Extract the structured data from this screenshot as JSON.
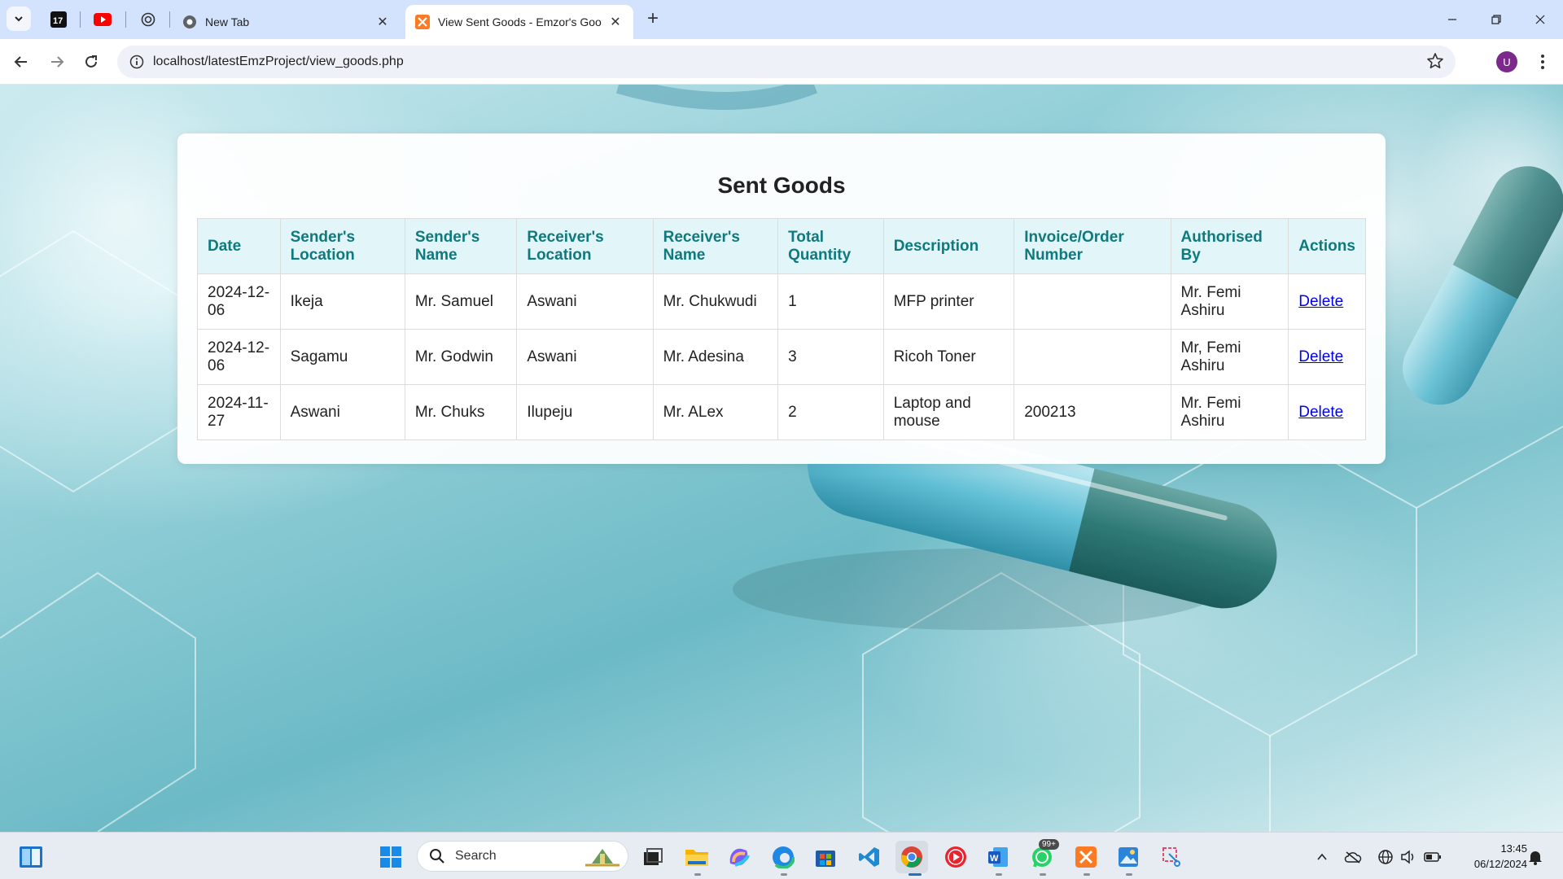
{
  "browser": {
    "tabs": [
      {
        "label": "New Tab"
      },
      {
        "label": "View Sent Goods - Emzor's Goo"
      }
    ],
    "url": "localhost/latestEmzProject/view_goods.php",
    "profile_initial": "U"
  },
  "page": {
    "heading": "Sent Goods",
    "columns": [
      "Date",
      "Sender's Location",
      "Sender's Name",
      "Receiver's Location",
      "Receiver's Name",
      "Total Quantity",
      "Description",
      "Invoice/Order Number",
      "Authorised By",
      "Actions"
    ],
    "rows": [
      {
        "date": "2024-12-06",
        "sender_location": "Ikeja",
        "sender_name": "Mr. Samuel",
        "receiver_location": "Aswani",
        "receiver_name": "Mr. Chukwudi",
        "quantity": "1",
        "description": "MFP printer",
        "invoice": "",
        "authorised_by": "Mr. Femi Ashiru",
        "action": "Delete"
      },
      {
        "date": "2024-12-06",
        "sender_location": "Sagamu",
        "sender_name": "Mr. Godwin",
        "receiver_location": "Aswani",
        "receiver_name": "Mr. Adesina",
        "quantity": "3",
        "description": "Ricoh Toner",
        "invoice": "",
        "authorised_by": "Mr, Femi Ashiru",
        "action": "Delete"
      },
      {
        "date": "2024-11-27",
        "sender_location": "Aswani",
        "sender_name": "Mr. Chuks",
        "receiver_location": "Ilupeju",
        "receiver_name": "Mr. ALex",
        "quantity": "2",
        "description": "Laptop and mouse",
        "invoice": "200213",
        "authorised_by": "Mr. Femi Ashiru",
        "action": "Delete"
      }
    ]
  },
  "taskbar": {
    "search_placeholder": "Search",
    "whatsapp_badge": "99+",
    "time": "13:45",
    "date": "06/12/2024"
  },
  "colors": {
    "header_text": "#0e7a7d",
    "header_bg": "#e2f5f8",
    "link": "#0000ee",
    "tabstrip": "#d3e3fd"
  }
}
